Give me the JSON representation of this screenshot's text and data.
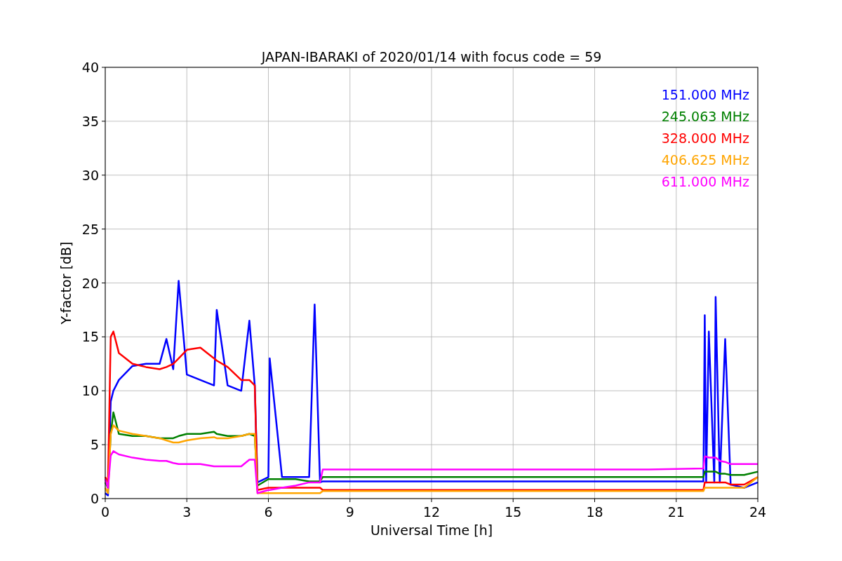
{
  "chart_data": {
    "type": "line",
    "title": "JAPAN-IBARAKI of 2020/01/14 with focus code = 59",
    "xlabel": "Universal Time [h]",
    "ylabel": "Y-factor [dB]",
    "x": [
      0,
      0.1,
      0.2,
      0.3,
      0.5,
      1,
      1.5,
      2,
      2.25,
      2.5,
      2.7,
      3,
      3.5,
      4,
      4.1,
      4.5,
      5,
      5.3,
      5.5,
      5.6,
      6,
      6.05,
      6.5,
      7,
      7.5,
      7.7,
      7.9,
      8,
      12,
      16,
      20,
      22,
      22.05,
      22.1,
      22.2,
      22.4,
      22.45,
      22.6,
      22.8,
      23,
      23.5,
      24
    ],
    "series": [
      {
        "name": "151.000 MHz",
        "color": "#0000ff",
        "values": [
          0.5,
          0.3,
          9,
          10,
          11,
          12.3,
          12.5,
          12.5,
          14.8,
          12,
          20.2,
          11.5,
          11,
          10.5,
          17.5,
          10.5,
          10,
          16.5,
          10.5,
          1.5,
          2,
          13,
          2,
          2,
          2,
          18,
          1.5,
          1.6,
          1.6,
          1.6,
          1.6,
          1.6,
          17,
          1.5,
          15.5,
          1.5,
          18.7,
          1.5,
          14.8,
          1.3,
          1,
          1.5
        ]
      },
      {
        "name": "245.063 MHz",
        "color": "#008000",
        "values": [
          1.5,
          1,
          6,
          8,
          6,
          5.8,
          5.8,
          5.6,
          5.6,
          5.6,
          5.8,
          6,
          6,
          6.2,
          6,
          5.8,
          5.8,
          6,
          5.8,
          1.2,
          1.8,
          1.8,
          1.8,
          1.8,
          1.6,
          1.6,
          1.6,
          2,
          2,
          2,
          2,
          2,
          2.5,
          2.5,
          2.5,
          2.5,
          2.5,
          2.3,
          2.3,
          2.2,
          2.2,
          2.5
        ]
      },
      {
        "name": "328.000 MHz",
        "color": "#ff0000",
        "values": [
          2,
          1.5,
          15,
          15.5,
          13.5,
          12.5,
          12.2,
          12,
          12.2,
          12.5,
          13,
          13.8,
          14,
          13,
          12.8,
          12.2,
          11,
          11,
          10.5,
          0.8,
          1,
          1,
          1,
          1,
          1,
          1,
          1,
          0.8,
          0.8,
          0.8,
          0.8,
          0.8,
          1.5,
          1.5,
          1.5,
          1.5,
          1.5,
          1.5,
          1.5,
          1.3,
          1.3,
          2
        ]
      },
      {
        "name": "406.625 MHz",
        "color": "#ffa500",
        "values": [
          1,
          0.5,
          6,
          6.8,
          6.3,
          6,
          5.8,
          5.6,
          5.4,
          5.2,
          5.2,
          5.4,
          5.6,
          5.7,
          5.6,
          5.6,
          5.8,
          6,
          6,
          0.5,
          0.5,
          0.5,
          0.5,
          0.5,
          0.5,
          0.5,
          0.5,
          0.7,
          0.7,
          0.7,
          0.7,
          0.7,
          1,
          1,
          1,
          1,
          1,
          1,
          1,
          1,
          1,
          2
        ]
      },
      {
        "name": "611.000 MHz",
        "color": "#ff00ff",
        "values": [
          1.8,
          1,
          4,
          4.4,
          4.1,
          3.8,
          3.6,
          3.5,
          3.5,
          3.3,
          3.2,
          3.2,
          3.2,
          3,
          3,
          3,
          3,
          3.6,
          3.6,
          0.5,
          0.8,
          0.8,
          1,
          1.2,
          1.5,
          1.5,
          1.5,
          2.7,
          2.7,
          2.7,
          2.7,
          2.8,
          3.9,
          3.9,
          3.8,
          3.8,
          3.8,
          3.5,
          3.4,
          3.2,
          3.2,
          3.2
        ]
      }
    ],
    "xlim": [
      0,
      24
    ],
    "ylim": [
      0,
      40
    ],
    "xticks": [
      0,
      3,
      6,
      9,
      12,
      15,
      18,
      21,
      24
    ],
    "yticks": [
      0,
      5,
      10,
      15,
      20,
      25,
      30,
      35,
      40
    ],
    "grid": true
  }
}
